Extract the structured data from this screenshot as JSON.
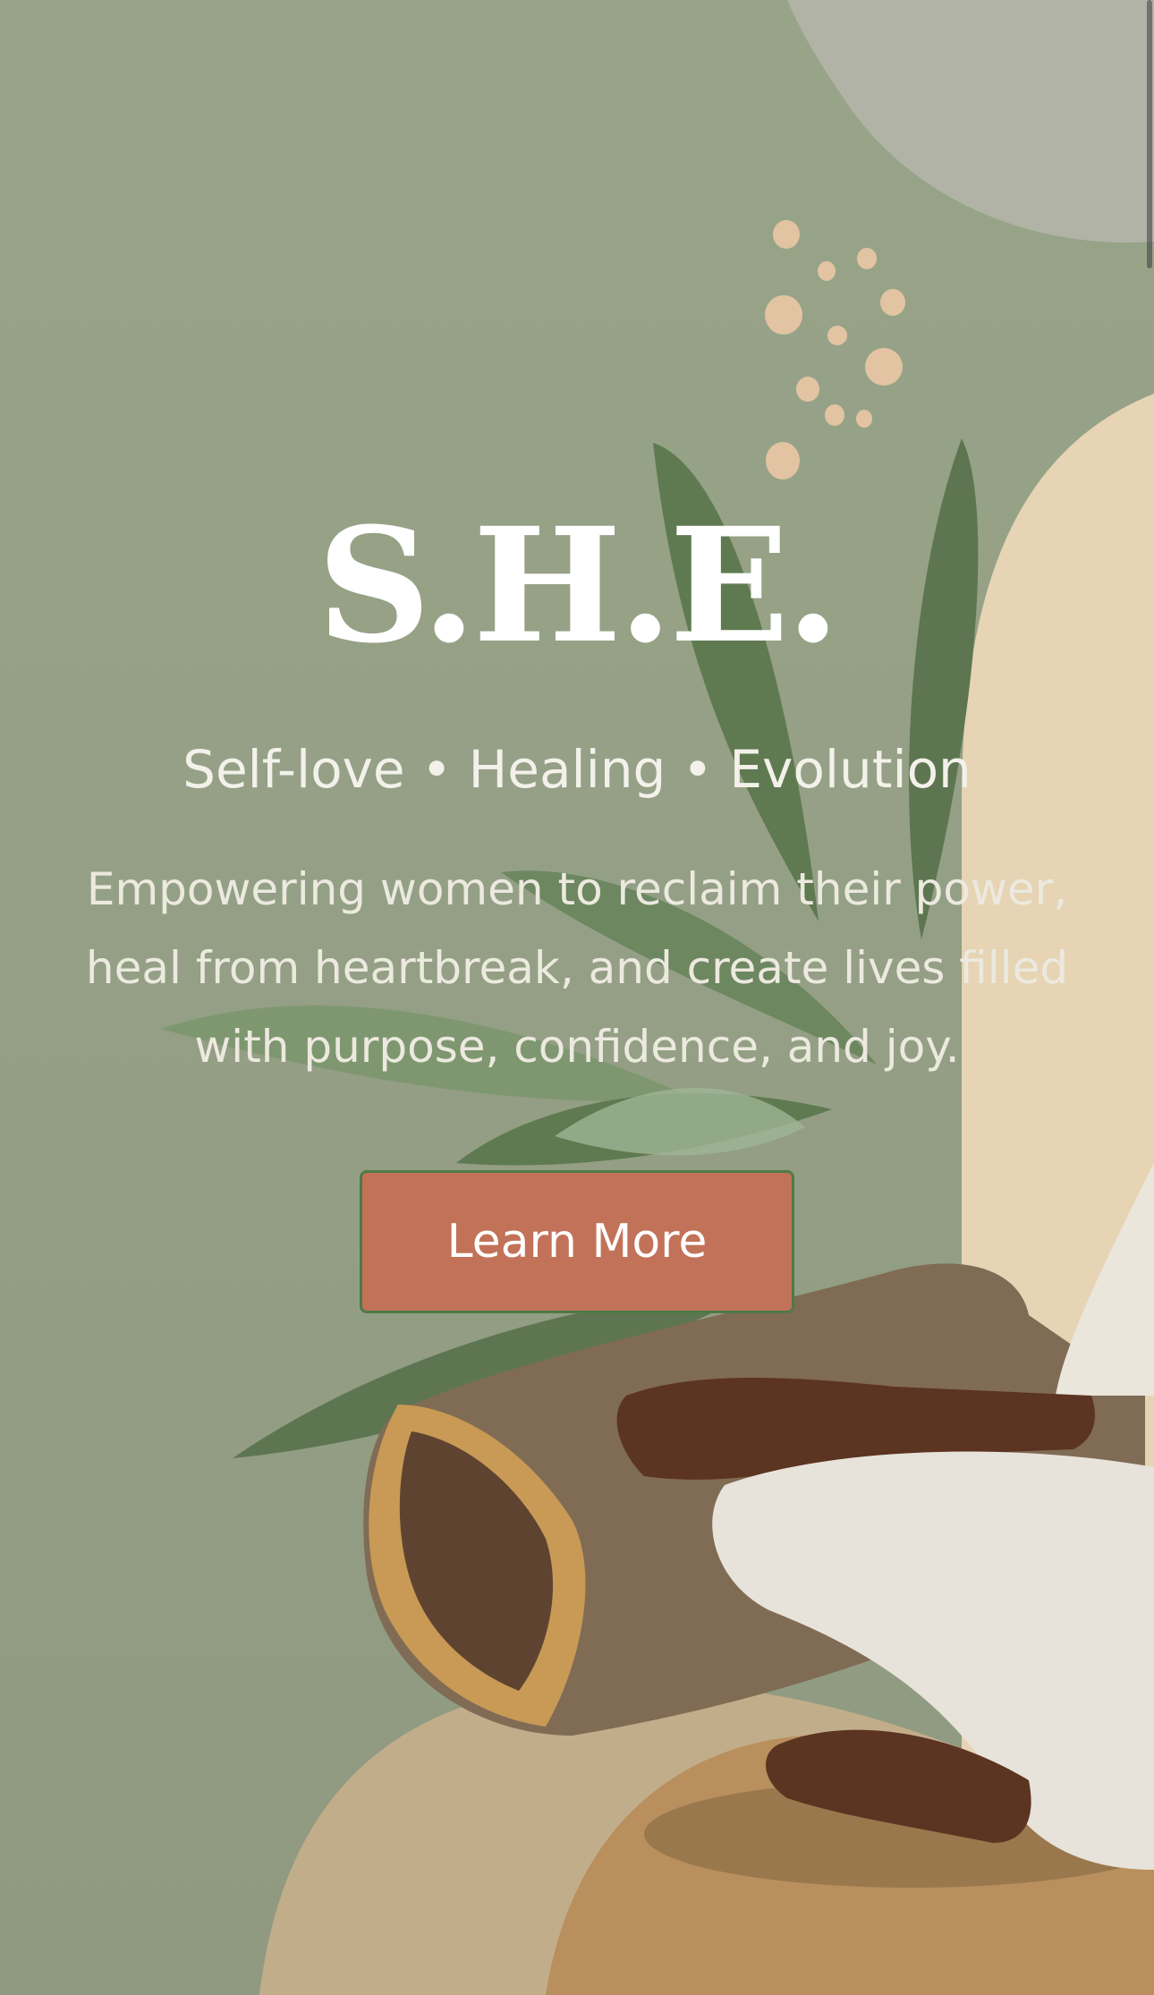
{
  "hero": {
    "title": "S.H.E.",
    "tagline": "Self-love • Healing • Evolution",
    "description": "Empowering women to reclaim their power, heal from heartbreak, and create lives filled with purpose, confidence, and joy.",
    "cta_label": "Learn More"
  },
  "colors": {
    "background_sage": "#959f85",
    "cta_fill": "#c27258",
    "cta_border": "#4f7a46",
    "title_text": "#ffffff",
    "body_text": "#ece9df"
  },
  "illustration": {
    "subject": "meditating-woman-illustration",
    "elements": [
      "sage-leaves-icon",
      "log-icon",
      "dots-decoration-icon",
      "sand-shapes"
    ]
  }
}
